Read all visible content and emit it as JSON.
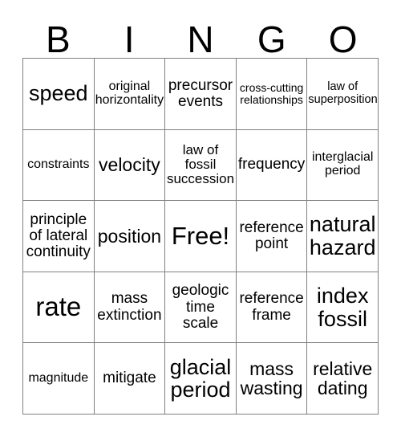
{
  "card": {
    "header_letters": [
      "B",
      "I",
      "N",
      "G",
      "O"
    ],
    "free_space_label": "Free!",
    "colors": {
      "text": "#000000",
      "grid_line": "#808080",
      "background": "#ffffff"
    },
    "grid": {
      "columns": 5,
      "rows": 5,
      "cells": [
        {
          "text": "speed",
          "size": "xl"
        },
        {
          "text": "original\nhorizontality",
          "size": "sm"
        },
        {
          "text": "precursor\nevents",
          "size": "md"
        },
        {
          "text": "cross-cutting\nrelationships",
          "size": "xs"
        },
        {
          "text": "law of\nsuperposition",
          "size": "sm"
        },
        {
          "text": "constraints",
          "size": "sm"
        },
        {
          "text": "velocity",
          "size": "lg"
        },
        {
          "text": "law of\nfossil\nsuccession",
          "size": "md"
        },
        {
          "text": "frequency",
          "size": "md"
        },
        {
          "text": "interglacial\nperiod",
          "size": "sm"
        },
        {
          "text": "principle\nof lateral\ncontinuity",
          "size": "md"
        },
        {
          "text": "position",
          "size": "lg"
        },
        {
          "text": "Free!",
          "size": "free"
        },
        {
          "text": "reference\npoint",
          "size": "md"
        },
        {
          "text": "natural\nhazard",
          "size": "xl"
        },
        {
          "text": "rate",
          "size": "xxl"
        },
        {
          "text": "mass\nextinction",
          "size": "md"
        },
        {
          "text": "geologic\ntime\nscale",
          "size": "md"
        },
        {
          "text": "reference\nframe",
          "size": "md"
        },
        {
          "text": "index\nfossil",
          "size": "xl"
        },
        {
          "text": "magnitude",
          "size": "sm"
        },
        {
          "text": "mitigate",
          "size": "md"
        },
        {
          "text": "glacial\nperiod",
          "size": "xl"
        },
        {
          "text": "mass\nwasting",
          "size": "lg"
        },
        {
          "text": "relative\ndating",
          "size": "lg"
        }
      ]
    }
  }
}
